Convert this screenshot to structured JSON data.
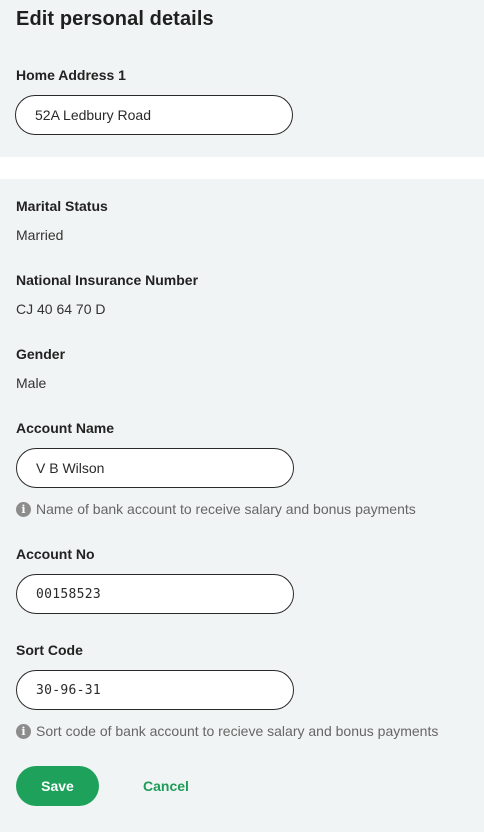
{
  "page_title": "Edit personal details",
  "home_address": {
    "label": "Home Address 1",
    "value": "52A Ledbury Road"
  },
  "marital_status": {
    "label": "Marital Status",
    "value": "Married"
  },
  "ni_number": {
    "label": "National Insurance Number",
    "value": "CJ 40 64 70 D"
  },
  "gender": {
    "label": "Gender",
    "value": "Male"
  },
  "account_name": {
    "label": "Account Name",
    "value": "V B Wilson",
    "hint": "Name of bank account to receive salary and bonus payments"
  },
  "account_no": {
    "label": "Account No",
    "value": "00158523"
  },
  "sort_code": {
    "label": "Sort Code",
    "value": "30-96-31",
    "hint": "Sort code of bank account to recieve salary and bonus payments"
  },
  "actions": {
    "save_label": "Save",
    "cancel_label": "Cancel"
  },
  "icons": {
    "info": "info-icon"
  },
  "colors": {
    "accent": "#1ea15b",
    "background": "#f1f4f4"
  }
}
